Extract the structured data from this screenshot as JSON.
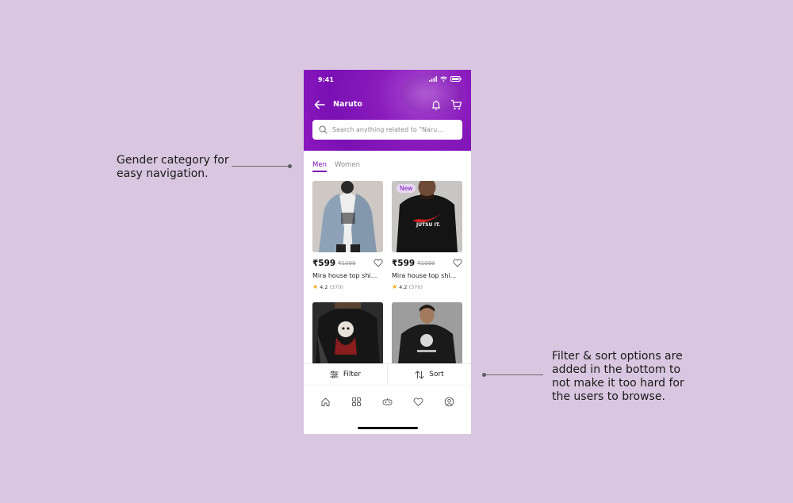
{
  "annotations": {
    "left": "Gender category for\neasy navigation.",
    "right": "Filter & sort options are\nadded in the bottom to\nnot make it too hard for\nthe users to browse."
  },
  "status_bar": {
    "time": "9:41"
  },
  "header": {
    "title": "Naruto"
  },
  "search": {
    "placeholder": "Search anything related to \"Naru..."
  },
  "tabs": [
    {
      "label": "Men",
      "active": true
    },
    {
      "label": "Women",
      "active": false
    }
  ],
  "products": [
    {
      "price": "₹599",
      "mrp": "₹1099",
      "name": "Mira house top shi...",
      "rating": "4.2",
      "reviews": "(370)",
      "badge": ""
    },
    {
      "price": "₹599",
      "mrp": "₹1099",
      "name": "Mira house top shi...",
      "rating": "4.2",
      "reviews": "(370)",
      "badge": "New",
      "print_text": "JUTSU IT."
    }
  ],
  "actions": {
    "filter": "Filter",
    "sort": "Sort"
  },
  "bottom_nav": [
    "home-icon",
    "categories-icon",
    "gamepad-icon",
    "wishlist-icon",
    "profile-icon"
  ],
  "colors": {
    "brand": "#7a10b3",
    "background": "#d9c6e0",
    "star": "#f3a815"
  }
}
